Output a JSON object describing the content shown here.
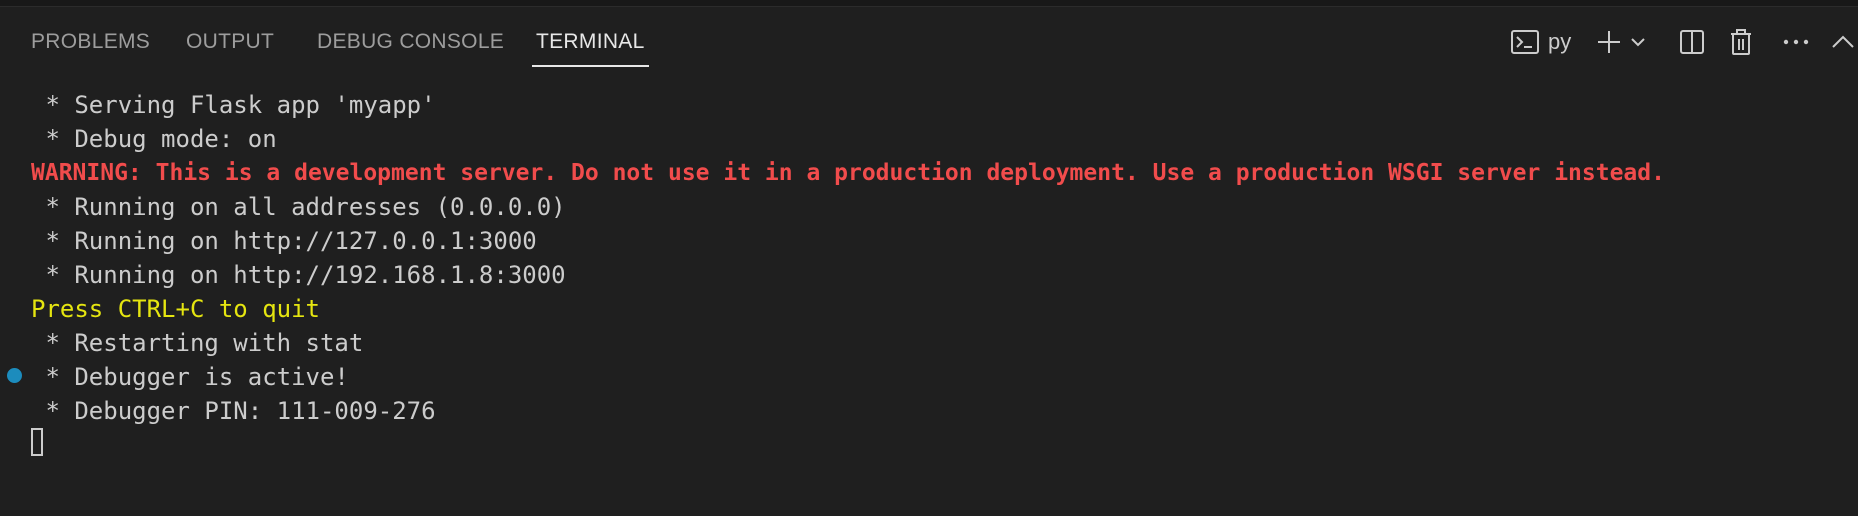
{
  "panel": {
    "tabs": [
      {
        "label": "PROBLEMS",
        "active": false
      },
      {
        "label": "OUTPUT",
        "active": false
      },
      {
        "label": "DEBUG CONSOLE",
        "active": false
      },
      {
        "label": "TERMINAL",
        "active": true
      }
    ],
    "actions": {
      "terminal_profile_label": "py",
      "icons": [
        "terminal-icon",
        "plus-icon",
        "chevron-down-icon",
        "split-editor-icon",
        "trash-icon",
        "ellipsis-icon",
        "chevron-up-icon"
      ]
    }
  },
  "terminal": {
    "lines": [
      {
        "text": " * Serving Flask app 'myapp'",
        "style": "normal"
      },
      {
        "text": " * Debug mode: on",
        "style": "normal"
      },
      {
        "text": "WARNING: This is a development server. Do not use it in a production deployment. Use a production WSGI server instead.",
        "style": "warn"
      },
      {
        "text": " * Running on all addresses (0.0.0.0)",
        "style": "normal"
      },
      {
        "text": " * Running on http://127.0.0.1:3000",
        "style": "normal"
      },
      {
        "text": " * Running on http://192.168.1.8:3000",
        "style": "normal"
      },
      {
        "text": "Press CTRL+C to quit",
        "style": "yellow"
      },
      {
        "text": " * Restarting with stat",
        "style": "normal"
      },
      {
        "text": " * Debugger is active!",
        "style": "normal",
        "decoration": true
      },
      {
        "text": " * Debugger PIN: 111-009-276",
        "style": "normal"
      }
    ]
  },
  "colors": {
    "background": "#1f1f1f",
    "text": "#cccccc",
    "warning": "#f14c4c",
    "notice": "#e5e510",
    "decoration": "#1c8cbd"
  }
}
